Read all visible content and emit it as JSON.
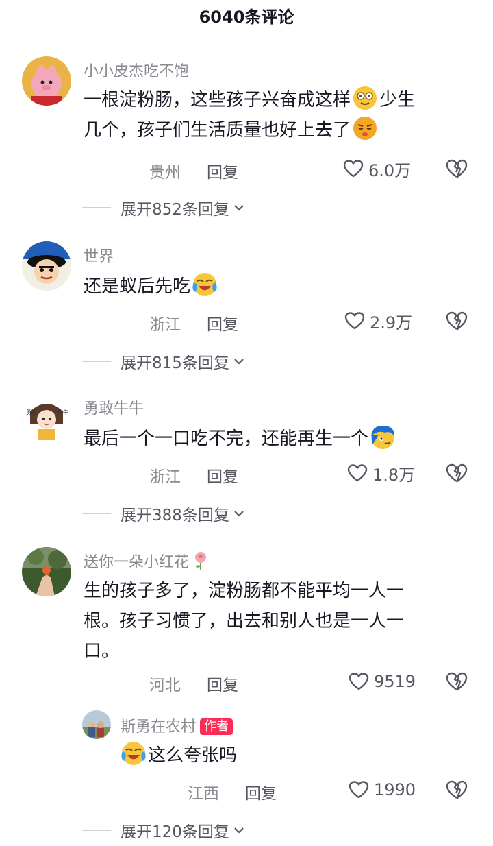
{
  "header": {
    "title": "6040条评论"
  },
  "comments": [
    {
      "username": "小小皮杰吃不饱",
      "text_a": "一根淀粉肠，这些孩子兴奋成这样",
      "text_b": "少生",
      "text_c": "几个，孩子们生活质量也好上去了",
      "location": "贵州",
      "reply_label": "回复",
      "likes": "6.0万",
      "expand": "展开852条回复"
    },
    {
      "username": "世界",
      "text_a": "还是蚁后先吃",
      "location": "浙江",
      "reply_label": "回复",
      "likes": "2.9万",
      "expand": "展开815条回复"
    },
    {
      "username": "勇敢牛牛",
      "text_a": "最后一个一口吃不完，还能再生一个",
      "location": "浙江",
      "reply_label": "回复",
      "likes": "1.8万",
      "expand": "展开388条回复"
    },
    {
      "username": "送你一朵小红花",
      "text_a": "生的孩子多了，淀粉肠都不能平均一人一",
      "text_b": "根。孩子习惯了，出去和别人也是一人一",
      "text_c": "口。",
      "location": "河北",
      "reply_label": "回复",
      "likes": "9519",
      "reply": {
        "username": "斯勇在农村",
        "badge": "作者",
        "text": "这么夸张吗",
        "location": "江西",
        "reply_label": "回复",
        "likes": "1990"
      },
      "expand": "展开120条回复"
    }
  ]
}
